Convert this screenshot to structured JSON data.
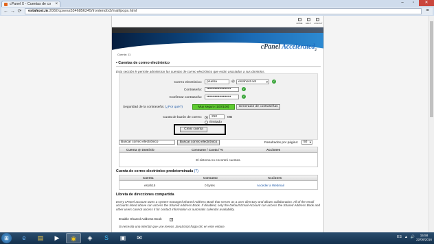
{
  "browser": {
    "tab_title": "cPanel X - Cuentas de co",
    "tab_close": "×",
    "window_controls": [
      "–",
      "▫",
      "✕"
    ],
    "url_host": "estahost.in",
    "url_path": ":2082/cpsess5346856245/frontend/x3/mail/pops.html",
    "back_icon": "←",
    "forward_icon": "→",
    "reload_icon": "⟳",
    "menu_icon": "≡"
  },
  "header": {
    "icons": [
      "HOME",
      "HELP",
      "LOGOUT"
    ],
    "logo_text": "cPanel",
    "logo_accent": "Accelerated",
    "logo_version": "2",
    "user_line": "Cuenta: 11"
  },
  "main": {
    "title": "Cuentas de correo electrónico",
    "description": "Esta sección le permite administrar las cuentas de correo electrónico que están asociadas a sus dominios."
  },
  "form": {
    "email_label": "Correo electrónico:",
    "email_value": "prueba",
    "at_sign": "@",
    "domain_value": "estahost.net",
    "password_label": "Contraseña:",
    "password_value": "•••••••••••••••••••••",
    "confirm_label": "Confirmar contraseña:",
    "confirm_value": "•••••••••••••••••••••",
    "strength_label": "Seguridad de la contraseña:",
    "strength_why": "(¿Por qué?)",
    "strength_value": "Muy seguro (100/100)",
    "generator_button": "Generador de contraseñas",
    "quota_label": "Cuota de buzón de correo:",
    "quota_value": "250",
    "quota_unit": "MB",
    "quota_unlimited": "Ilimitado",
    "create_button": "Crear cuenta"
  },
  "search": {
    "placeholder": "Buscar correo electrónico",
    "value": "Buscar correo electrónico",
    "button": "Buscar correo electrónico",
    "per_page_label": "Resultados por página:",
    "per_page_value": "50"
  },
  "accounts_table": {
    "columns": [
      "Cuenta @ Dominio",
      "Consumo / Cuota / %",
      "Acciones"
    ],
    "empty_message": "El sistema no encontró cuentas."
  },
  "default_account": {
    "title": "Cuenta de correo electrónico predeterminada",
    "help": "(?)",
    "columns": [
      "Cuenta",
      "Consumo",
      "Acciones"
    ],
    "row": {
      "account": "estah15",
      "usage": "0 bytes",
      "action": "Acceder a Webmail"
    }
  },
  "address_book": {
    "title": "Libreta de direcciones compartida",
    "text": "Every cPanel account owns a system-managed Shared Address Book that serves as a user directory and allows collaboration. All of the email accounts listed above can access the Shared Address Book. If disabled, only the Default Email Account can access the Shared Address Book and other users cannot access it for contact information or automatic calendar availability.",
    "enable_label": "Enable Shared Address Book",
    "enabled_mark": "✓",
    "footer_note": "Si necesita una interfaz que use menos JavaScript haga clic en este enlace."
  },
  "taskbar": {
    "start_icon": "⊞",
    "items": [
      "e",
      "▤",
      "▶",
      "◉",
      "◈",
      "S",
      "▣",
      "✉"
    ],
    "tray": [
      "ES",
      "▲",
      "🔊"
    ],
    "time": "15:58",
    "date": "22/06/2016"
  }
}
